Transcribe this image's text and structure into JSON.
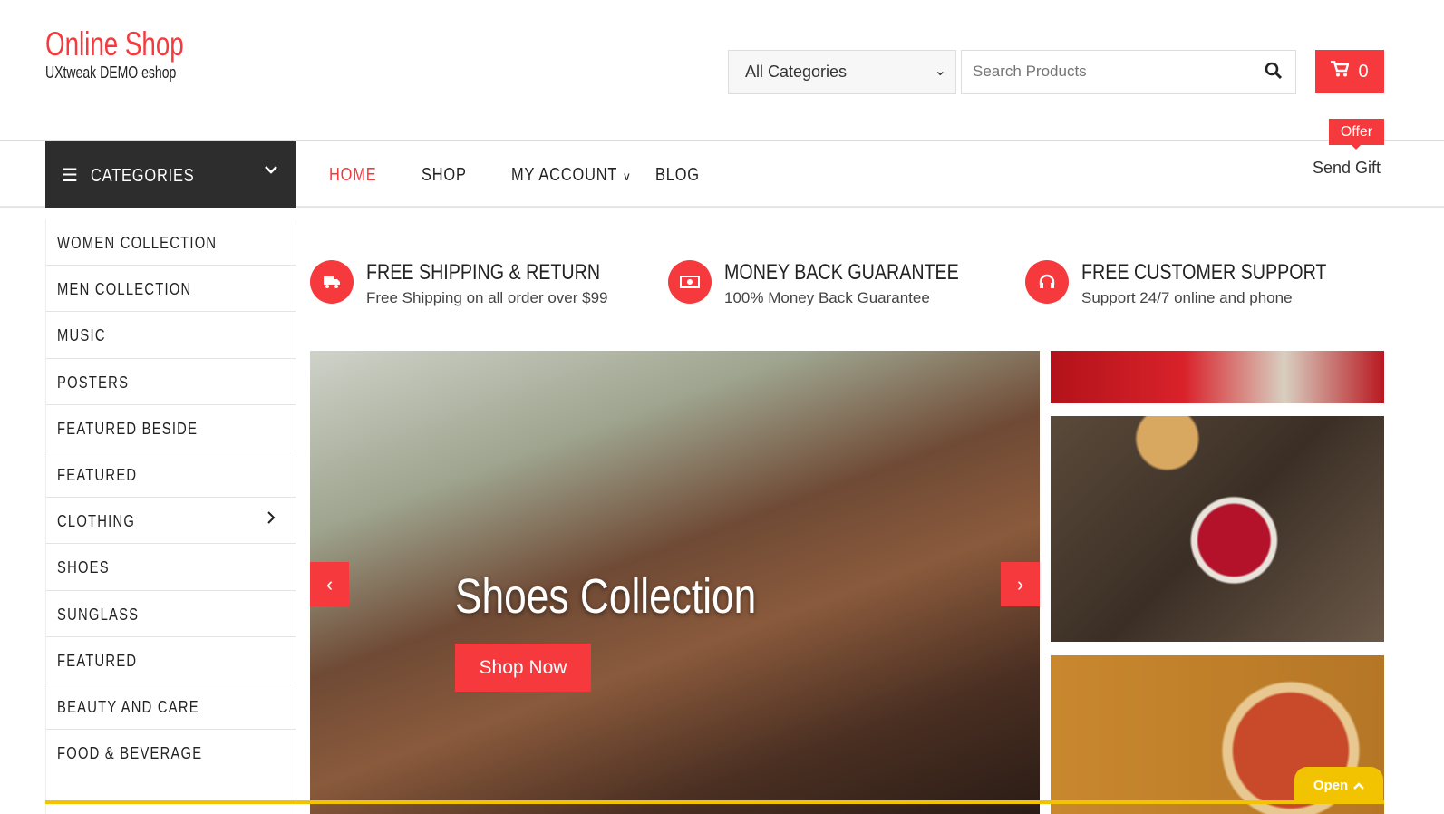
{
  "brand": {
    "title": "Online Shop",
    "subtitle": "UXtweak DEMO eshop"
  },
  "header": {
    "category_select": "All Categories",
    "search_placeholder": "Search Products",
    "cart_count": "0"
  },
  "nav": {
    "categories_label": "CATEGORIES",
    "items": [
      "HOME",
      "SHOP",
      "MY ACCOUNT",
      "BLOG"
    ],
    "offer_badge": "Offer",
    "send_gift": "Send Gift"
  },
  "sidebar": {
    "items": [
      "WOMEN COLLECTION",
      "MEN COLLECTION",
      "MUSIC",
      "POSTERS",
      "FEATURED BESIDE",
      "FEATURED",
      "CLOTHING",
      "SHOES",
      "SUNGLASS",
      "FEATURED",
      "BEAUTY AND CARE",
      "FOOD & BEVERAGE"
    ]
  },
  "features": [
    {
      "title": "FREE SHIPPING & RETURN",
      "text": "Free Shipping on all order over $99",
      "icon": "truck-icon"
    },
    {
      "title": "MONEY BACK GUARANTEE",
      "text": "100% Money Back Guarantee",
      "icon": "money-icon"
    },
    {
      "title": "FREE CUSTOMER SUPPORT",
      "text": "Support 24/7 online and phone",
      "icon": "headset-icon"
    }
  ],
  "slider": {
    "title": "Shoes Collection",
    "button": "Shop Now"
  },
  "widget": {
    "open_label": "Open"
  },
  "colors": {
    "accent": "#f6393d",
    "dark": "#2d2d2d",
    "widget": "#f2c300"
  }
}
